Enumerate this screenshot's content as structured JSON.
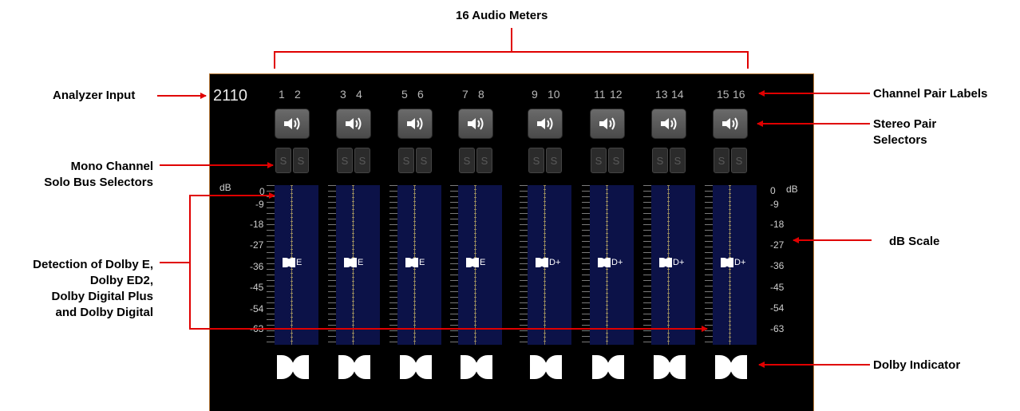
{
  "annotations": {
    "title": "16 Audio Meters",
    "analyzer_input": "Analyzer Input",
    "mono_solo": [
      "Mono Channel",
      "Solo Bus Selectors"
    ],
    "dolby_detect": [
      "Detection of Dolby E,",
      "Dolby ED2,",
      "Dolby Digital Plus",
      "and Dolby Digital"
    ],
    "channel_pair_labels": "Channel Pair Labels",
    "stereo_pair": [
      "Stereo Pair",
      "Selectors"
    ],
    "db_scale": "dB Scale",
    "dolby_indicator": "Dolby Indicator"
  },
  "panel": {
    "input": "2110",
    "db_unit": "dB",
    "scale_left": [
      "0",
      "-9",
      "-18",
      "-27",
      "-36",
      "-45",
      "-54",
      "-63"
    ],
    "scale_right": [
      "0",
      "-9",
      "-18",
      "-27",
      "-36",
      "-45",
      "-54",
      "-63"
    ],
    "solo_label": "S",
    "pairs": [
      {
        "ch1": "1",
        "ch2": "2",
        "format": "E"
      },
      {
        "ch1": "3",
        "ch2": "4",
        "format": "E"
      },
      {
        "ch1": "5",
        "ch2": "6",
        "format": "E"
      },
      {
        "ch1": "7",
        "ch2": "8",
        "format": "E"
      },
      {
        "ch1": "9",
        "ch2": "10",
        "format": "D+"
      },
      {
        "ch1": "11",
        "ch2": "12",
        "format": "D+"
      },
      {
        "ch1": "13",
        "ch2": "14",
        "format": "D+"
      },
      {
        "ch1": "15",
        "ch2": "16",
        "format": "D+"
      }
    ]
  },
  "colors": {
    "annotation": "#e00000",
    "meter_bg": "#0c1248",
    "panel_border": "#b87a3a"
  }
}
